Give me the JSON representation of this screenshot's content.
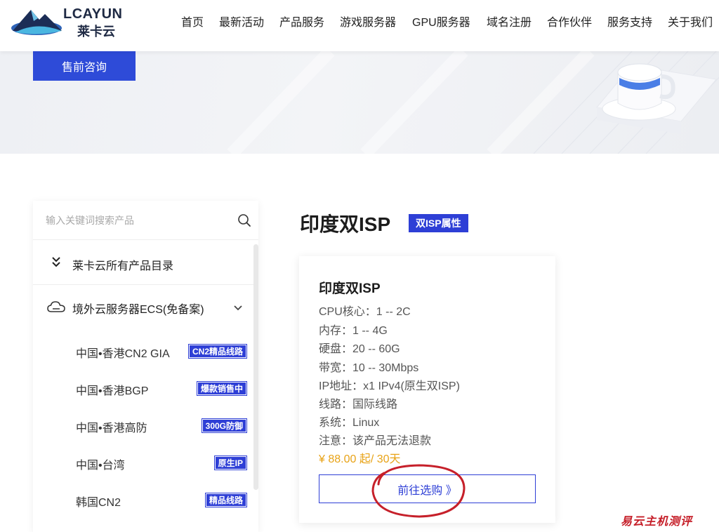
{
  "header": {
    "brand_en": "LCAYUN",
    "brand_cn": "莱卡云",
    "nav": [
      "首页",
      "最新活动",
      "产品服务",
      "游戏服务器",
      "GPU服务器",
      "域名注册",
      "合作伙伴",
      "服务支持",
      "关于我们"
    ]
  },
  "banner": {
    "consult_label": "售前咨询"
  },
  "sidebar": {
    "search_placeholder": "输入关键词搜索产品",
    "catalog_label": "莱卡云所有产品目录",
    "group_label": "境外云服务器ECS(免备案)",
    "items": [
      {
        "label": "中国•香港CN2 GIA",
        "tag": "CN2精品线路"
      },
      {
        "label": "中国•香港BGP",
        "tag": "爆款销售中"
      },
      {
        "label": "中国•香港高防",
        "tag": "300G防御"
      },
      {
        "label": "中国•台湾",
        "tag": "原生IP"
      },
      {
        "label": "韩国CN2",
        "tag": "精品线路"
      }
    ]
  },
  "main": {
    "title": "印度双ISP",
    "badge": "双ISP属性",
    "card": {
      "title": "印度双ISP",
      "specs": [
        "CPU核心：1 -- 2C",
        "内存：1 -- 4G",
        "硬盘：20 -- 60G",
        "带宽：10 -- 30Mbps",
        "IP地址：x1 IPv4(原生双ISP)",
        "线路：国际线路",
        "系统：Linux",
        "注意：该产品无法退款"
      ],
      "price": "¥ 88.00 起/ 30天",
      "buy_label": "前往选购 》"
    }
  },
  "watermark": "易云主机测评",
  "colors": {
    "accent": "#2e3fd6",
    "price": "#e8a317",
    "annotation": "#c6202a"
  }
}
